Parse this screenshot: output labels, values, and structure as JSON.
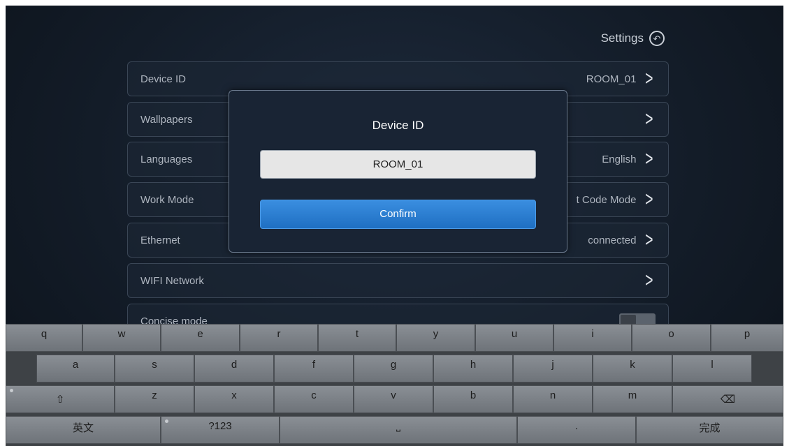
{
  "header": {
    "title": "Settings",
    "back_icon": "back-icon"
  },
  "settings": [
    {
      "label": "Device ID",
      "value": "ROOM_01"
    },
    {
      "label": "Wallpapers",
      "value": ""
    },
    {
      "label": "Languages",
      "value": "English"
    },
    {
      "label": "Work Mode",
      "value": "t Code Mode"
    },
    {
      "label": "Ethernet",
      "value": "connected"
    },
    {
      "label": "WIFI Network",
      "value": ""
    },
    {
      "label": "Concise mode",
      "toggle": false
    }
  ],
  "dialog": {
    "title": "Device ID",
    "input_value": "ROOM_01",
    "confirm_label": "Confirm"
  },
  "keyboard": {
    "row1": [
      "q",
      "w",
      "e",
      "r",
      "t",
      "y",
      "u",
      "i",
      "o",
      "p"
    ],
    "row2": [
      "a",
      "s",
      "d",
      "f",
      "g",
      "h",
      "j",
      "k",
      "l"
    ],
    "row3": [
      "z",
      "x",
      "c",
      "v",
      "b",
      "n",
      "m"
    ],
    "shift": "⇧",
    "del": "⌫",
    "lang": "英文",
    "sym": "?123",
    "space": "⎵",
    "period": ".",
    "done": "完成"
  }
}
